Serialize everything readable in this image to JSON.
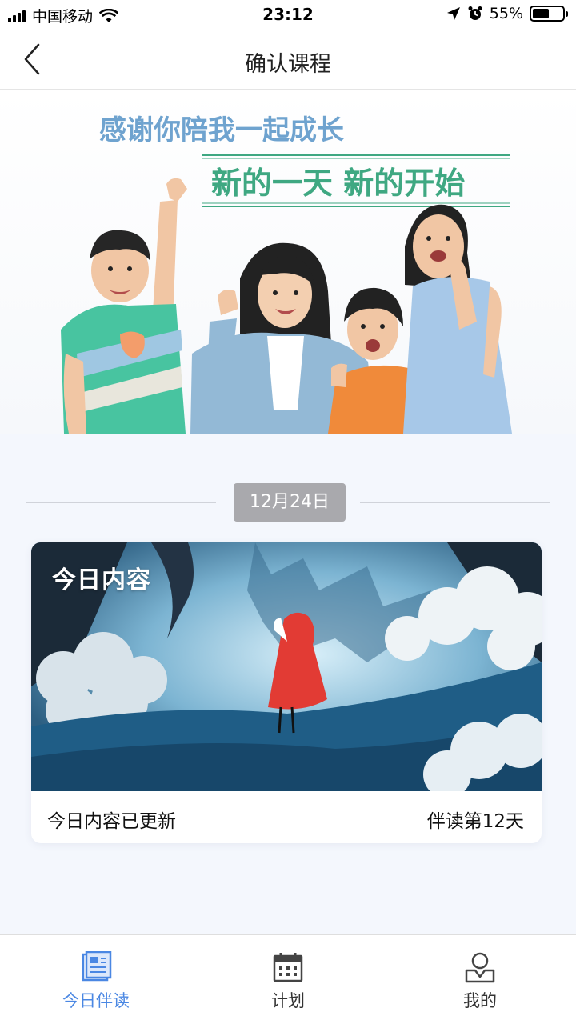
{
  "status_bar": {
    "carrier": "中国移动",
    "time": "23:12",
    "battery_percent": "55%",
    "battery_level": 0.55
  },
  "nav": {
    "title": "确认课程",
    "back_icon": "chevron-left-icon"
  },
  "banner": {
    "line1": "感谢你陪我一起成长",
    "line2": "新的一天 新的开始"
  },
  "date_label": "12月24日",
  "card": {
    "title": "今日内容",
    "status": "今日内容已更新",
    "day_count": "伴读第12天"
  },
  "tabs": [
    {
      "label": "今日伴读",
      "icon": "reading-doc-icon",
      "active": true
    },
    {
      "label": "计划",
      "icon": "calendar-icon",
      "active": false
    },
    {
      "label": "我的",
      "icon": "profile-icon",
      "active": false
    }
  ],
  "colors": {
    "accent": "#4a87e3",
    "background": "#f4f7fd",
    "banner_line1": "#6fa3cf",
    "banner_line2": "#3fa882",
    "date_pill": "#a9a9ad"
  }
}
